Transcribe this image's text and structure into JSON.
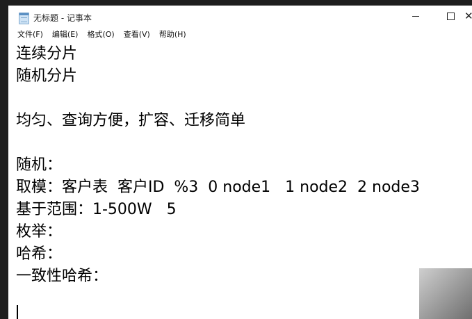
{
  "window": {
    "title": "无标题 - 记事本",
    "app_icon": "notepad-icon",
    "controls": {
      "minimize": "minimize-icon",
      "maximize": "maximize-icon",
      "close": "close-icon"
    }
  },
  "menu": [
    {
      "label": "文件(F)"
    },
    {
      "label": "编辑(E)"
    },
    {
      "label": "格式(O)"
    },
    {
      "label": "查看(V)"
    },
    {
      "label": "帮助(H)"
    }
  ],
  "document": {
    "lines": [
      "连续分片",
      "随机分片",
      "",
      "均匀、查询方便，扩容、迁移简单",
      "",
      "随机：",
      "取模：客户表  客户ID  %3  0 node1   1 node2  2 node3",
      "基于范围：1-500W   5",
      "枚举：",
      "哈希：",
      "一致性哈希：",
      ""
    ]
  }
}
